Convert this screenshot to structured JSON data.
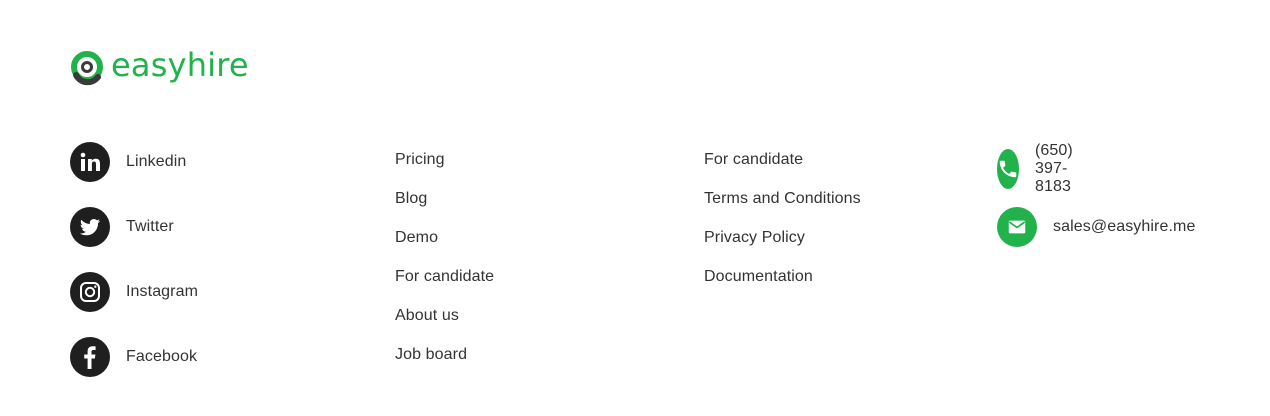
{
  "brand": {
    "name": "easyhire",
    "color": "#21b24b"
  },
  "social": [
    {
      "label": "Linkedin",
      "icon": "linkedin-icon"
    },
    {
      "label": "Twitter",
      "icon": "twitter-icon"
    },
    {
      "label": "Instagram",
      "icon": "instagram-icon"
    },
    {
      "label": "Facebook",
      "icon": "facebook-icon"
    }
  ],
  "links_primary": [
    {
      "label": "Pricing"
    },
    {
      "label": "Blog"
    },
    {
      "label": "Demo"
    },
    {
      "label": "For candidate"
    },
    {
      "label": "About us"
    },
    {
      "label": "Job board"
    }
  ],
  "links_secondary": [
    {
      "label": "For candidate"
    },
    {
      "label": "Terms and Conditions"
    },
    {
      "label": "Privacy Policy"
    },
    {
      "label": "Documentation"
    }
  ],
  "contact": {
    "phone": "(650) 397-8183",
    "email": "sales@easyhire.me"
  },
  "colors": {
    "text": "#333333",
    "icon_dark": "#1f1f1f",
    "accent": "#21b24b"
  }
}
